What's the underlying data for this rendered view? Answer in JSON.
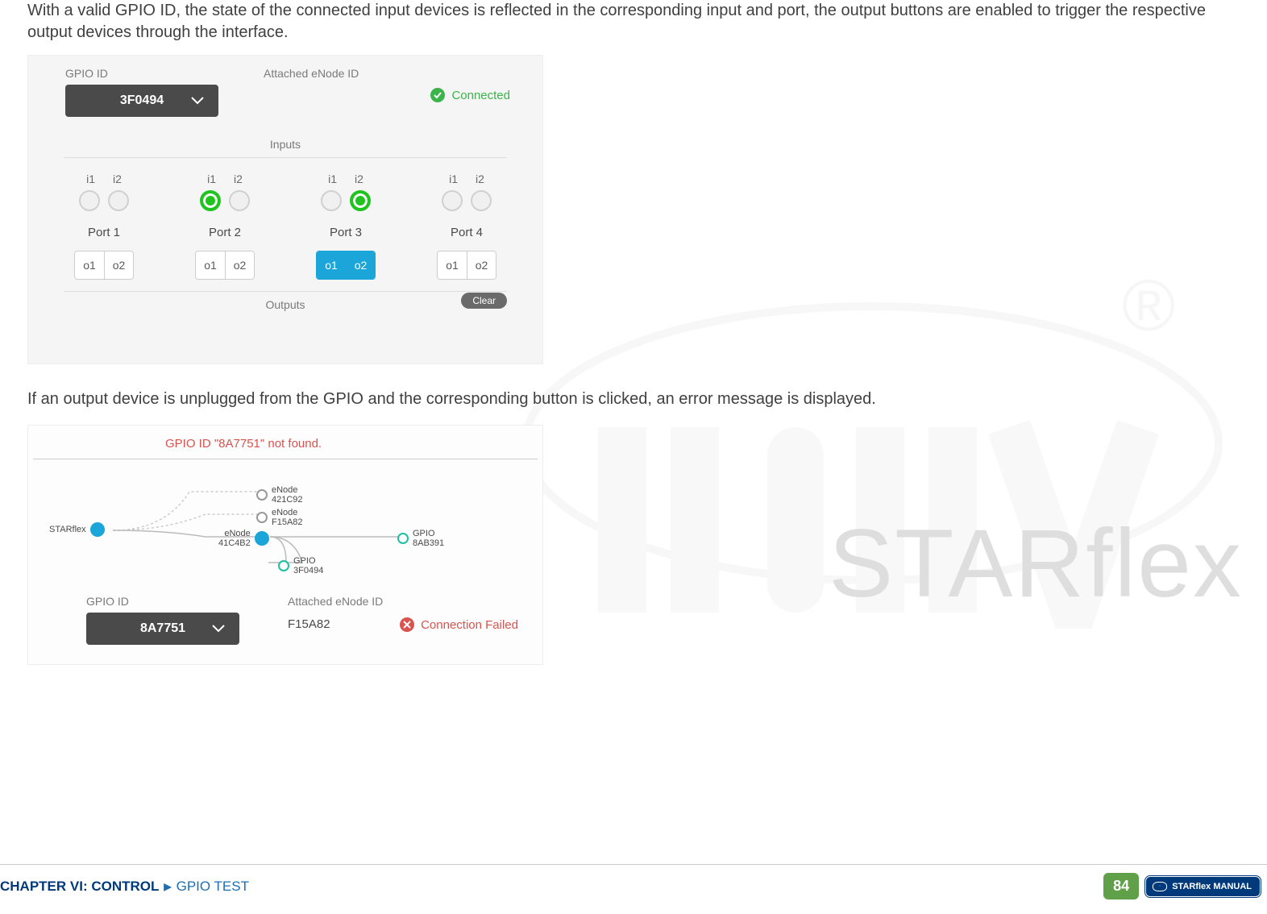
{
  "intro_text": "With a valid GPIO ID, the state of the connected input devices is reflected in the corresponding input and port, the output buttons are enabled to trigger the respective output devices through the interface.",
  "panel1": {
    "gpio_label": "GPIO ID",
    "gpio_value": "3F0494",
    "attached_label": "Attached eNode ID",
    "status_text": "Connected",
    "inputs_label": "Inputs",
    "outputs_label": "Outputs",
    "clear_label": "Clear",
    "input_headers": [
      "i1",
      "i2"
    ],
    "output_headers": [
      "o1",
      "o2"
    ],
    "ports": [
      {
        "name": "Port 1",
        "inputs": [
          false,
          false
        ],
        "output_active": false
      },
      {
        "name": "Port 2",
        "inputs": [
          true,
          false
        ],
        "output_active": false
      },
      {
        "name": "Port 3",
        "inputs": [
          false,
          true
        ],
        "output_active": true
      },
      {
        "name": "Port 4",
        "inputs": [
          false,
          false
        ],
        "output_active": false
      }
    ]
  },
  "mid_text": "If an output device is unplugged from the GPIO and the corresponding button is clicked, an error message is displayed.",
  "panel2": {
    "error_text": "GPIO ID \"8A7751\" not found.",
    "topology": {
      "root": "STARflex",
      "nodes": [
        {
          "type": "eNode",
          "id": "421C92"
        },
        {
          "type": "eNode",
          "id": "F15A82"
        },
        {
          "type": "eNode",
          "id": "41C4B2",
          "active": true,
          "children": [
            {
              "type": "GPIO",
              "id": "8AB391"
            },
            {
              "type": "GPIO",
              "id": "3F0494"
            }
          ]
        }
      ]
    },
    "gpio_label": "GPIO ID",
    "gpio_value": "8A7751",
    "attached_label": "Attached eNode ID",
    "attached_value": "F15A82",
    "status_text": "Connection Failed"
  },
  "footer": {
    "chapter": "CHAPTER VI: CONTROL",
    "section": "GPIO TEST",
    "page": "84",
    "manual": "STARflex MANUAL"
  },
  "watermark2": "STARflex"
}
